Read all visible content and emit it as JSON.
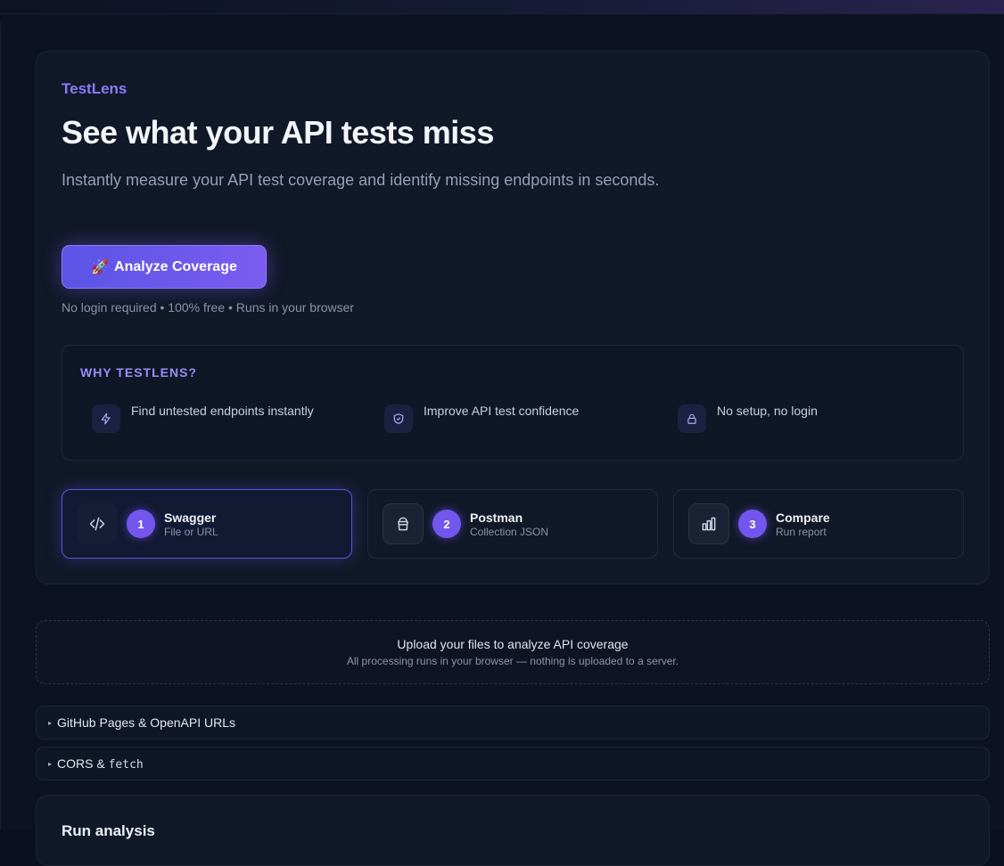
{
  "hero": {
    "brand": "TestLens",
    "headline": "See what your API tests miss",
    "subhead": "Instantly measure your API test coverage and identify missing endpoints in seconds.",
    "cta_label": "Analyze Coverage",
    "cta_icon": "rocket-emoji",
    "cta_glyph": "🚀",
    "note": "No login required • 100% free • Runs in your browser"
  },
  "why": {
    "title": "WHY TESTLENS?",
    "features": [
      {
        "icon": "lightning-icon",
        "text": "Find untested endpoints instantly"
      },
      {
        "icon": "shield-check-icon",
        "text": "Improve API test confidence"
      },
      {
        "icon": "lock-icon",
        "text": "No setup, no login"
      }
    ]
  },
  "steps": [
    {
      "number": "1",
      "title": "Swagger",
      "subtitle": "File or URL",
      "icon": "code-icon",
      "active": true
    },
    {
      "number": "2",
      "title": "Postman",
      "subtitle": "Collection JSON",
      "icon": "archive-icon",
      "active": false
    },
    {
      "number": "3",
      "title": "Compare",
      "subtitle": "Run report",
      "icon": "bar-chart-icon",
      "active": false
    }
  ],
  "upload": {
    "title": "Upload your files to analyze API coverage",
    "subtitle": "All processing runs in your browser — nothing is uploaded to a server."
  },
  "sections": {
    "github": {
      "label": "GitHub Pages & OpenAPI URLs"
    },
    "cors": {
      "label": "CORS & ",
      "code": "fetch"
    }
  },
  "run": {
    "title": "Run analysis"
  },
  "colors": {
    "accent": "#7356ee",
    "brand": "#8b7cf6",
    "background": "#0c1222",
    "card": "#111827"
  }
}
